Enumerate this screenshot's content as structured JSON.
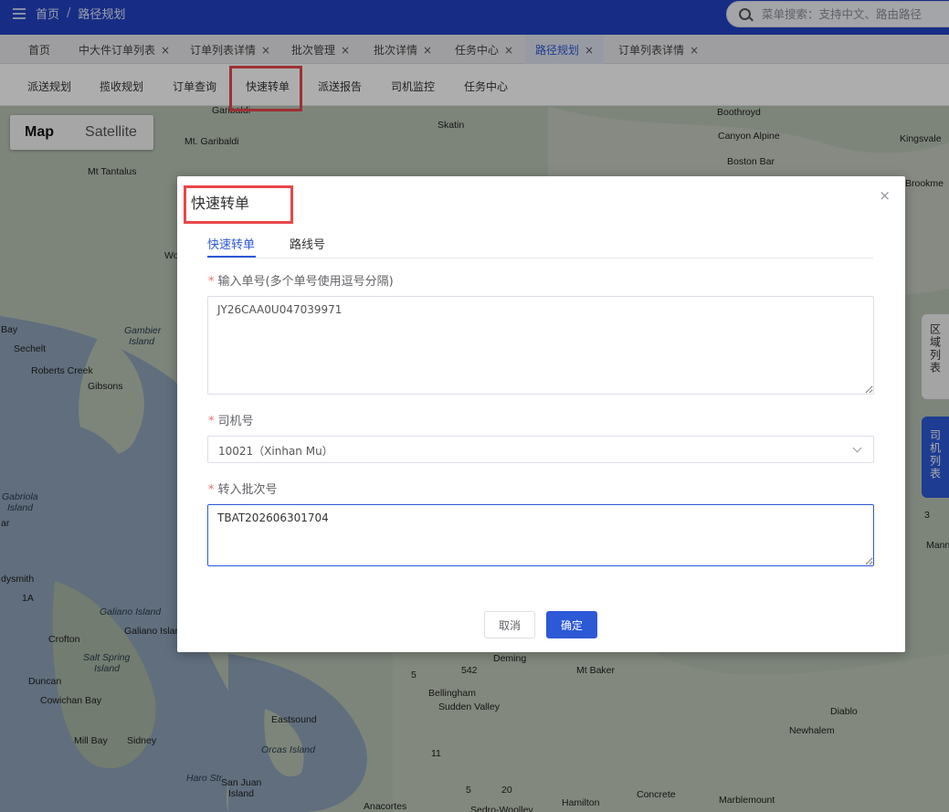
{
  "header": {
    "home": "首页",
    "separator": "/",
    "current": "路径规划",
    "search_placeholder": "菜单搜索：支持中文、路由路径"
  },
  "tabs": [
    {
      "label": "首页",
      "closable": false
    },
    {
      "label": "中大件订单列表",
      "closable": true
    },
    {
      "label": "订单列表详情",
      "closable": true
    },
    {
      "label": "批次管理",
      "closable": true
    },
    {
      "label": "批次详情",
      "closable": true
    },
    {
      "label": "任务中心",
      "closable": true
    },
    {
      "label": "路径规划",
      "closable": true,
      "active": true
    },
    {
      "label": "订单列表详情",
      "closable": true
    }
  ],
  "tab_close_glyph": "×",
  "subnav": [
    "派送规划",
    "揽收规划",
    "订单查询",
    "快速转单",
    "派送报告",
    "司机监控",
    "任务中心"
  ],
  "map": {
    "toggle": {
      "map": "Map",
      "satellite": "Satellite"
    },
    "labels": [
      "Garibaldi",
      "Mt. Garibaldi",
      "Mt Tantalus",
      "Skatin",
      "Boothroyd",
      "Canyon Alpine",
      "Kingsvale",
      "Boston Bar",
      "Brookme",
      "Wo",
      "Bay",
      "Sechelt",
      "Gambier",
      "Island",
      "Roberts Creek",
      "Gibsons",
      "Gabriola",
      "Island",
      "ar",
      "dysmith",
      "1A",
      "Galiano Island",
      "Galiano Island",
      "Crofton",
      "Salt Spring",
      "Island",
      "Duncan",
      "Cowichan Bay",
      "Mill Bay",
      "Sidney",
      "Eastsound",
      "Orcas Island",
      "San Juan",
      "Island",
      "Haro Str",
      "Anacortes",
      "Deming",
      "Mt Baker",
      "542",
      "5",
      "Bellingham",
      "Sudden Valley",
      "11",
      "5",
      "20",
      "Hamilton",
      "Concrete",
      "Marblemount",
      "Diablo",
      "Newhalem",
      "Sedro-Woolley",
      "3",
      "Mann"
    ],
    "side_region": "区域列表",
    "side_driver": "司机列表"
  },
  "dialog": {
    "title": "快速转单",
    "close": "×",
    "tabs": [
      "快速转单",
      "路线号"
    ],
    "order_label": "输入单号(多个单号使用逗号分隔)",
    "order_value": "JY26CAA0U047039971",
    "driver_label": "司机号",
    "driver_value": "10021（Xinhan Mu）",
    "batch_label": "转入批次号",
    "batch_value": "TBAT202606301704",
    "required_mark": "*",
    "cancel": "取消",
    "confirm": "确定"
  },
  "colors": {
    "header_bg": "#2243c4",
    "accent": "#2d59d6",
    "highlight_box": "#e8474a"
  }
}
